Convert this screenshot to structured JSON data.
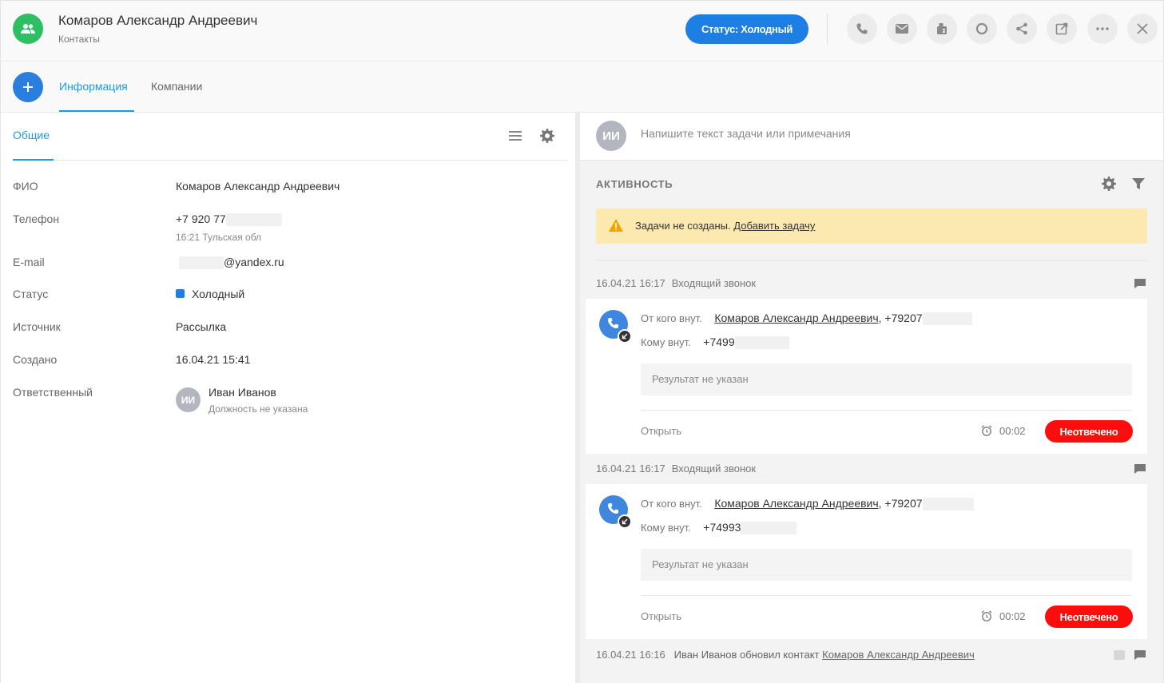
{
  "header": {
    "title": "Комаров Александр Андреевич",
    "subtitle": "Контакты",
    "status_button": "Статус: Холодный",
    "icons": [
      "phone-icon",
      "mail-icon",
      "fax-icon",
      "circle-icon",
      "share-icon",
      "external-link-icon",
      "more-icon",
      "close-icon"
    ]
  },
  "tabs": [
    {
      "label": "Информация",
      "active": true
    },
    {
      "label": "Компании",
      "active": false
    }
  ],
  "left": {
    "section_tab": "Общие",
    "fields": {
      "fio_label": "ФИО",
      "fio_value": "Комаров Александр Андреевич",
      "phone_label": "Телефон",
      "phone_value": "+7 920 77",
      "phone_sub": "16:21 Тульская обл",
      "email_label": "E-mail",
      "email_value": "@yandex.ru",
      "status_label": "Статус",
      "status_value": "Холодный",
      "source_label": "Источник",
      "source_value": "Рассылка",
      "created_label": "Создано",
      "created_value": "16.04.21 15:41",
      "owner_label": "Ответственный",
      "owner_initials": "ИИ",
      "owner_name": "Иван Иванов",
      "owner_position": "Должность не указана"
    }
  },
  "right": {
    "note_avatar": "ИИ",
    "note_placeholder": "Напишите текст задачи или примечания",
    "activity_title": "АКТИВНОСТЬ",
    "warning_text": "Задачи не созданы.",
    "warning_link": "Добавить задачу",
    "events": [
      {
        "datetime": "16.04.21 16:17",
        "type": "Входящий звонок",
        "from_label": "От кого внут.",
        "from_name": "Комаров Александр Андреевич",
        "from_phone": ", +79207",
        "to_label": "Кому внут.",
        "to_phone": "+7499",
        "result": "Результат не указан",
        "open": "Открыть",
        "duration": "00:02",
        "status": "Неотвечено"
      },
      {
        "datetime": "16.04.21 16:17",
        "type": "Входящий звонок",
        "from_label": "От кого внут.",
        "from_name": "Комаров Александр Андреевич",
        "from_phone": ", +79207",
        "to_label": "Кому внут.",
        "to_phone": "+74993",
        "result": "Результат не указан",
        "open": "Открыть",
        "duration": "00:02",
        "status": "Неотвечено"
      }
    ],
    "update": {
      "datetime": "16.04.21 16:16",
      "text": "Иван Иванов обновил контакт",
      "link": "Комаров Александр Андреевич"
    }
  },
  "colors": {
    "accent": "#1c9ce0",
    "button_blue": "#1d7fe3",
    "contact_green": "#2fbf63",
    "missed_red": "#ff0d0d",
    "warning_bg": "#fbe9b0"
  }
}
